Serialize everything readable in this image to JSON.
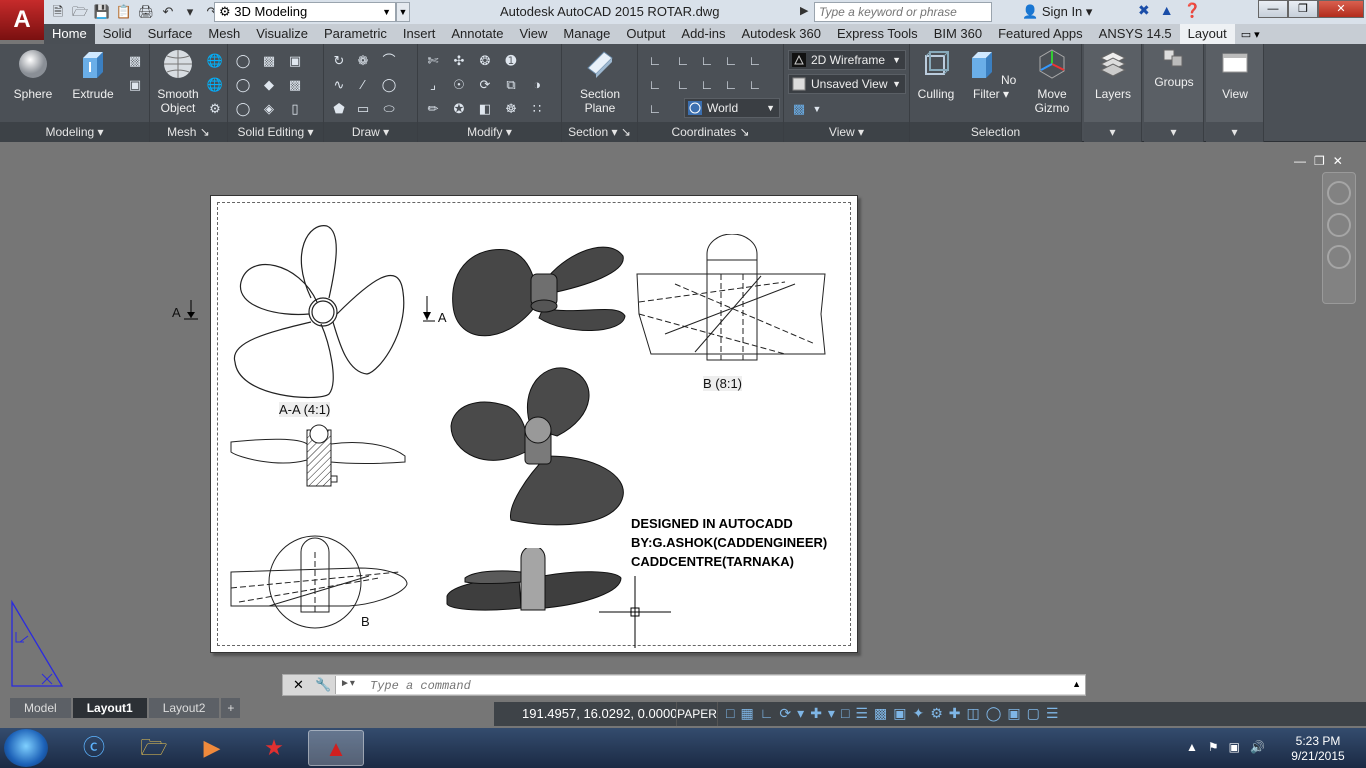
{
  "app": {
    "logo": "A",
    "workspace": "3D Modeling",
    "title": "Autodesk AutoCAD 2015    ROTAR.dwg",
    "search_placeholder": "Type a keyword or phrase",
    "sign_in": "Sign In"
  },
  "tabs": [
    "Home",
    "Solid",
    "Surface",
    "Mesh",
    "Visualize",
    "Parametric",
    "Insert",
    "Annotate",
    "View",
    "Manage",
    "Output",
    "Add-ins",
    "Autodesk 360",
    "Express Tools",
    "BIM 360",
    "Featured Apps",
    "ANSYS 14.5",
    "Layout"
  ],
  "ribbon": {
    "sphere": "Sphere",
    "extrude": "Extrude",
    "smooth_object": "Smooth Object",
    "section_plane": "Section Plane",
    "visual_style": "2D Wireframe",
    "view_name": "Unsaved View",
    "ucs": "World",
    "culling": "Culling",
    "no_filter": "No Filter",
    "move_gizmo": "Move Gizmo",
    "layers": "Layers",
    "groups": "Groups",
    "view": "View",
    "panels": {
      "modeling": "Modeling",
      "mesh": "Mesh",
      "solid_editing": "Solid Editing",
      "draw": "Draw",
      "modify": "Modify",
      "section": "Section",
      "coordinates": "Coordinates",
      "view": "View",
      "selection": "Selection"
    }
  },
  "drawing": {
    "section_label": "A",
    "view_aa": "A-A  (4:1)",
    "view_b": "B  (8:1)",
    "b_marker": "B",
    "designed_lines": [
      "DESIGNED IN AUTOCADD",
      "BY:G.ASHOK(CADDENGINEER)",
      "CADDCENTRE(TARNAKA)"
    ]
  },
  "command": {
    "placeholder": "Type a command"
  },
  "layout_tabs": [
    "Model",
    "Layout1",
    "Layout2"
  ],
  "status": {
    "coords": "191.4957, 16.0292, 0.0000",
    "space": "PAPER"
  },
  "taskbar": {
    "time": "5:23 PM",
    "date": "9/21/2015"
  }
}
